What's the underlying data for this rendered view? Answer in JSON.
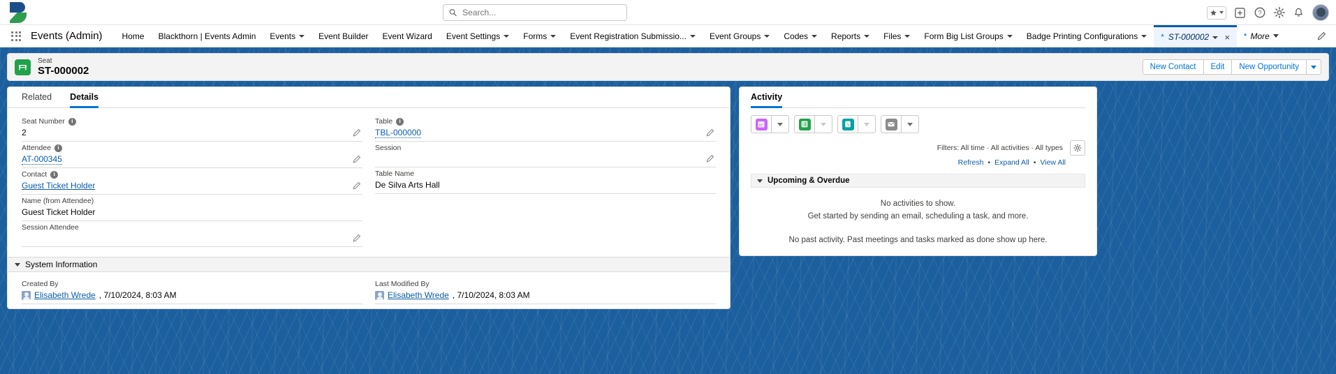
{
  "browser": {
    "search_placeholder": "Search...",
    "icons": [
      "favorites-star-icon",
      "add-app-icon",
      "help-icon",
      "setup-gear-icon",
      "notifications-bell-icon",
      "user-avatar"
    ]
  },
  "app": {
    "name": "Events (Admin)",
    "nav_items": [
      {
        "label": "Home",
        "has_menu": false
      },
      {
        "label": "Blackthorn | Events Admin",
        "has_menu": false
      },
      {
        "label": "Events",
        "has_menu": true
      },
      {
        "label": "Event Builder",
        "has_menu": false
      },
      {
        "label": "Event Wizard",
        "has_menu": false
      },
      {
        "label": "Event Settings",
        "has_menu": true
      },
      {
        "label": "Forms",
        "has_menu": true
      },
      {
        "label": "Event Registration Submissio...",
        "has_menu": true
      },
      {
        "label": "Event Groups",
        "has_menu": true
      },
      {
        "label": "Codes",
        "has_menu": true
      },
      {
        "label": "Reports",
        "has_menu": true
      },
      {
        "label": "Files",
        "has_menu": true
      },
      {
        "label": "Form Big List Groups",
        "has_menu": true
      },
      {
        "label": "Badge Printing Configurations",
        "has_menu": true
      }
    ],
    "active_tab": {
      "star": "*",
      "label": "ST-000002",
      "close": "×"
    },
    "more_tab": {
      "star": "*",
      "label": "More"
    }
  },
  "record_header": {
    "object_label": "Seat",
    "record_name": "ST-000002",
    "icon": "seat-icon",
    "buttons": [
      "New Contact",
      "Edit",
      "New Opportunity"
    ],
    "more_actions": "more-actions-caret"
  },
  "detail": {
    "tabs": [
      {
        "label": "Related",
        "active": false
      },
      {
        "label": "Details",
        "active": true
      }
    ],
    "fields_left": [
      {
        "label": "Seat Number",
        "value": "2",
        "info": true,
        "link": false,
        "editable": true
      },
      {
        "label": "Attendee",
        "value": "AT-000345",
        "info": true,
        "link": true,
        "link_style": "dotted",
        "editable": true
      },
      {
        "label": "Contact",
        "value": "Guest Ticket Holder",
        "info": true,
        "link": true,
        "link_style": "solid",
        "editable": true
      },
      {
        "label": "Name (from Attendee)",
        "value": "Guest Ticket Holder",
        "info": false,
        "link": false,
        "editable": false
      },
      {
        "label": "Session Attendee",
        "value": "",
        "info": false,
        "link": false,
        "editable": true
      }
    ],
    "fields_right": [
      {
        "label": "Table",
        "value": "TBL-000000",
        "info": true,
        "link": true,
        "link_style": "dotted",
        "editable": true
      },
      {
        "label": "Session",
        "value": "",
        "info": false,
        "link": false,
        "editable": true
      },
      {
        "label": "Table Name",
        "value": "De Silva Arts Hall",
        "info": false,
        "link": false,
        "editable": false
      }
    ],
    "system_information": {
      "title": "System Information",
      "created_by": {
        "label": "Created By",
        "user": "Elisabeth Wrede",
        "meta": ", 7/10/2024, 8:03 AM"
      },
      "last_modified_by": {
        "label": "Last Modified By",
        "user": "Elisabeth Wrede",
        "meta": ", 7/10/2024, 8:03 AM"
      }
    }
  },
  "activity": {
    "tab_label": "Activity",
    "composer": [
      {
        "name": "new-event",
        "icon": "calendar-icon",
        "color": "#cb65ff"
      },
      {
        "name": "new-task",
        "icon": "task-list-icon",
        "color": "#23a24a"
      },
      {
        "name": "log-a-call",
        "icon": "phone-icon",
        "color": "#00a3a1"
      },
      {
        "name": "email",
        "icon": "email-icon",
        "color": "#8b8b8b"
      }
    ],
    "filters_text": "Filters: All time · All activities · All types",
    "links": [
      "Refresh",
      "Expand All",
      "View All"
    ],
    "link_separator": "•",
    "upcoming_section": "Upcoming & Overdue",
    "empty_title": "No activities to show.",
    "empty_sub": "Get started by sending an email, scheduling a task, and more.",
    "no_past": "No past activity. Past meetings and tasks marked as done show up here."
  },
  "colors": {
    "brand_blue": "#1b5f9e",
    "link_blue": "#0b5cab",
    "accent_blue": "#0176d3",
    "seat_green": "#21a24a"
  }
}
